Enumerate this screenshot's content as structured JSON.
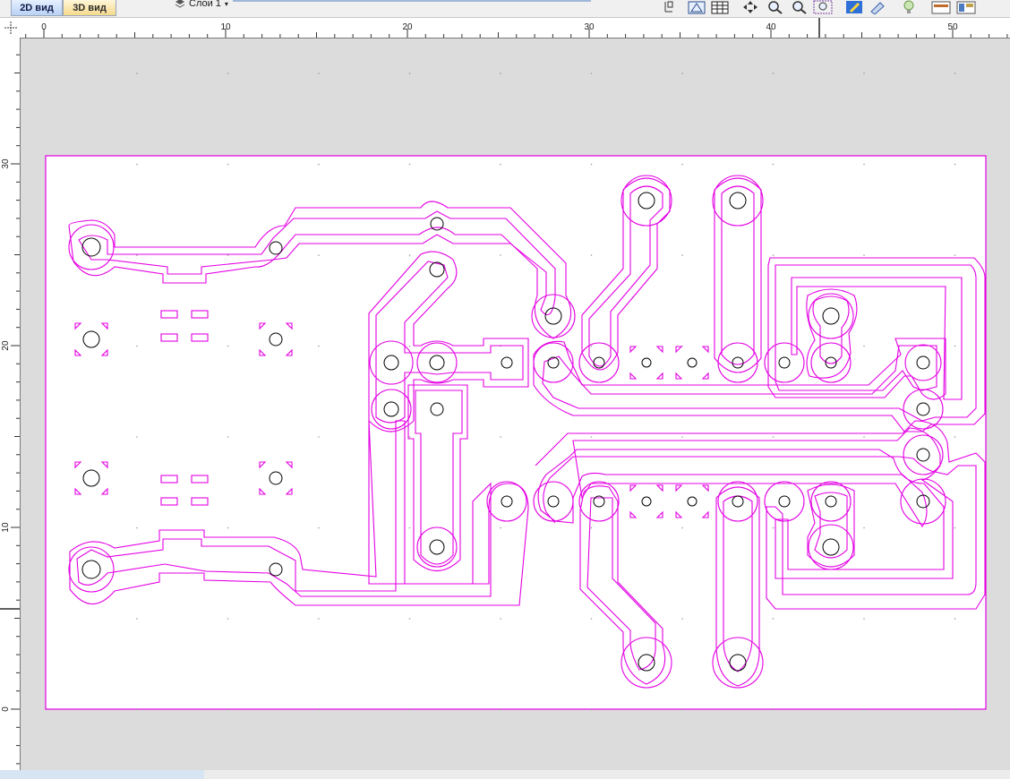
{
  "tabs": {
    "tab_2d": "2D вид",
    "tab_3d": "3D вид"
  },
  "layer": {
    "label": "Слои 1"
  },
  "ruler": {
    "h_labels": [
      "0",
      "10",
      "20",
      "30",
      "40",
      "50"
    ],
    "v_labels": [
      "30",
      "20",
      "10",
      "0"
    ]
  },
  "colors": {
    "track": "#e400e4",
    "pad": "#000000",
    "board": "#ffffff",
    "workspace": "#dcdcdc"
  },
  "toolbar_icons": [
    "select-icon",
    "layer-view-icon",
    "grid-icon",
    "pan-icon",
    "zoom-in-icon",
    "zoom-out-icon",
    "zoom-fit-icon",
    "edit-icon",
    "properties-icon",
    "light-icon",
    "settings-icon",
    "panel-icon"
  ]
}
